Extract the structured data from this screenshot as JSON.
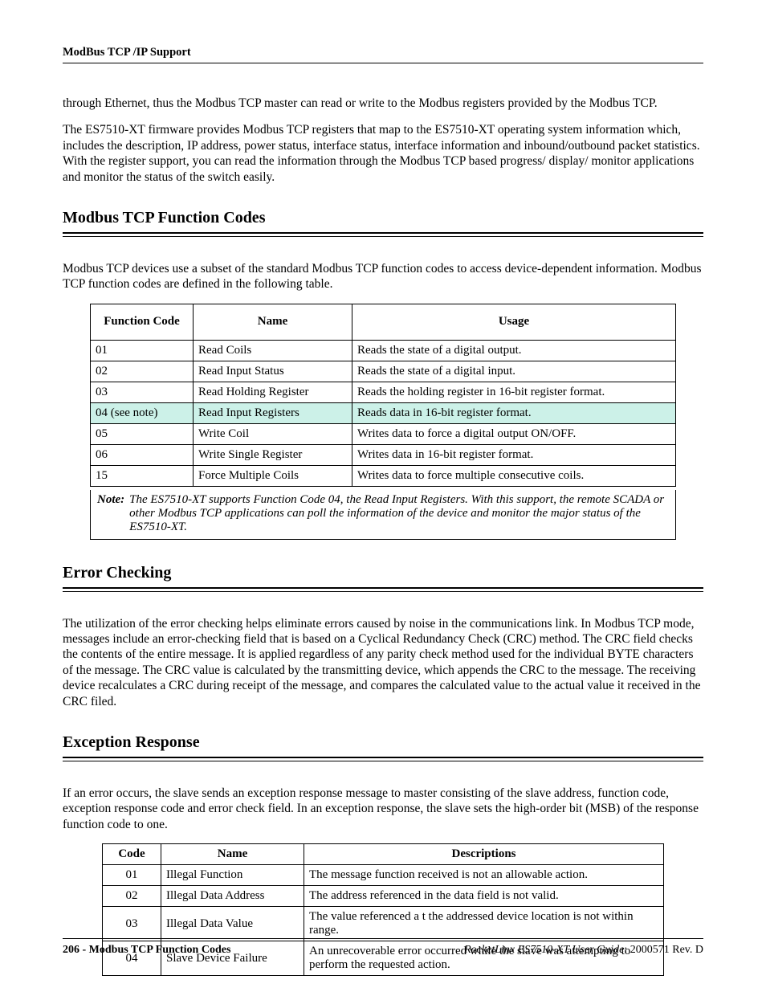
{
  "header": {
    "title": "ModBus TCP /IP Support"
  },
  "intro": {
    "p1": "through Ethernet, thus the Modbus TCP master can read or write to the Modbus registers provided by the Modbus TCP.",
    "p2": "The ES7510-XT firmware provides Modbus TCP registers that map to the ES7510-XT operating system information which, includes the description, IP address, power status, interface status, interface information and inbound/outbound packet statistics. With the register support, you can read the information through the Modbus TCP based progress/ display/ monitor applications and monitor the status of the switch easily."
  },
  "section1": {
    "heading": "Modbus TCP Function Codes",
    "p1": "Modbus TCP devices use a subset of the standard Modbus TCP function codes to access device-dependent information. Modbus TCP function codes are defined in the following table.",
    "headers": {
      "code": "Function Code",
      "name": "Name",
      "usage": "Usage"
    },
    "rows": [
      {
        "code": "01",
        "name": "Read Coils",
        "usage": "Reads the state of a digital output."
      },
      {
        "code": "02",
        "name": "Read Input Status",
        "usage": "Reads the state of a digital input."
      },
      {
        "code": "03",
        "name": "Read Holding Register",
        "usage": "Reads the holding register in 16-bit register format."
      },
      {
        "code": "04 (see note)",
        "name": "Read Input Registers",
        "usage": "Reads data in 16-bit register format."
      },
      {
        "code": "05",
        "name": "Write Coil",
        "usage": "Writes data to force a digital output ON/OFF."
      },
      {
        "code": "06",
        "name": "Write Single Register",
        "usage": "Writes data in 16-bit register format."
      },
      {
        "code": "15",
        "name": "Force Multiple Coils",
        "usage": "Writes data to force multiple consecutive coils."
      }
    ],
    "note_label": "Note:",
    "note_body": "The ES7510-XT supports Function Code 04, the Read Input Registers. With this support, the remote SCADA or other Modbus TCP applications can poll the information of the device and monitor the major status of the ES7510-XT."
  },
  "section2": {
    "heading": "Error Checking",
    "p1": "The utilization of the error checking helps eliminate errors caused by noise in the communications link. In Modbus TCP mode, messages include an error-checking field that is based on a Cyclical Redundancy Check (CRC) method. The CRC field checks the contents of the entire message. It is applied regardless of any parity check method used for the individual BYTE characters of the message. The CRC value is calculated by the transmitting device, which appends the CRC to the message. The receiving device recalculates a CRC during receipt of the message, and compares the calculated value to the actual value it received in the CRC filed."
  },
  "section3": {
    "heading": "Exception Response",
    "p1": "If an error occurs, the slave sends an exception response message to master consisting of the slave address, function code, exception response code and error check field. In an exception response, the slave sets the high-order bit (MSB) of the response function code to one.",
    "headers": {
      "code": "Code",
      "name": "Name",
      "desc": "Descriptions"
    },
    "rows": [
      {
        "code": "01",
        "name": "Illegal Function",
        "desc": "The  message function  received  is  not an allowable action."
      },
      {
        "code": "02",
        "name": "Illegal Data Address",
        "desc": "The address referenced in the data field is not valid."
      },
      {
        "code": "03",
        "name": "Illegal Data Value",
        "desc": "The value  referenced a t the  addressed device location is not within range."
      },
      {
        "code": "04",
        "name": "Slave Device Failure",
        "desc": "An unrecoverable error occurred while the slave was attempting to perform the requested action."
      }
    ]
  },
  "footer": {
    "left": "206 - Modbus TCP Function Codes",
    "right_italic": "RocketLinx ES7510-XT  User Guide",
    "right_tail": ": 2000571 Rev. D"
  }
}
